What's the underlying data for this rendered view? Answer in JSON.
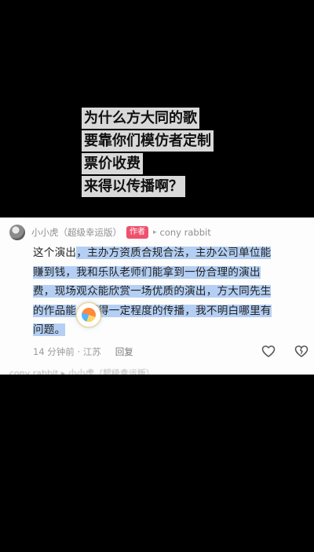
{
  "caption": {
    "lines": [
      "为什么方大同的歌",
      "要靠你们模仿者定制",
      "票价收费",
      "来得以传播啊？"
    ]
  },
  "comment": {
    "username": "小小虎（超级幸运版）",
    "author_tag": "作者",
    "reply_arrow": "▸",
    "reply_to": "cony rabbit",
    "body_segments": [
      {
        "text": "这个演出",
        "highlight": false
      },
      {
        "text": "，主办方资质合规合法，主办公司单位能",
        "highlight": true
      },
      {
        "text": "赚到钱，我和乐队老师们能拿到一份合理的演出",
        "highlight": true
      },
      {
        "text": "费，现场观众能欣赏一场优质的演出，方大同先生",
        "highlight": true
      },
      {
        "text": "的作品能",
        "highlight": true
      },
      {
        "text": "获得一定程度的传播，我不明白哪里有",
        "highlight": true
      },
      {
        "text": "问题。",
        "highlight": true
      }
    ],
    "time": "14 分钟前 · 江苏",
    "reply_label": "回复",
    "like_icon": "heart-outline-icon",
    "dislike_icon": "broken-heart-icon"
  },
  "next_comment_peek": "cony rabbit ▸ 小小虎（超级幸运版）",
  "colors": {
    "highlight": "#78aaeb",
    "author_tag_bg": "#f0506e",
    "panel_bg": "#fdfdfd",
    "page_bg": "#000000"
  }
}
